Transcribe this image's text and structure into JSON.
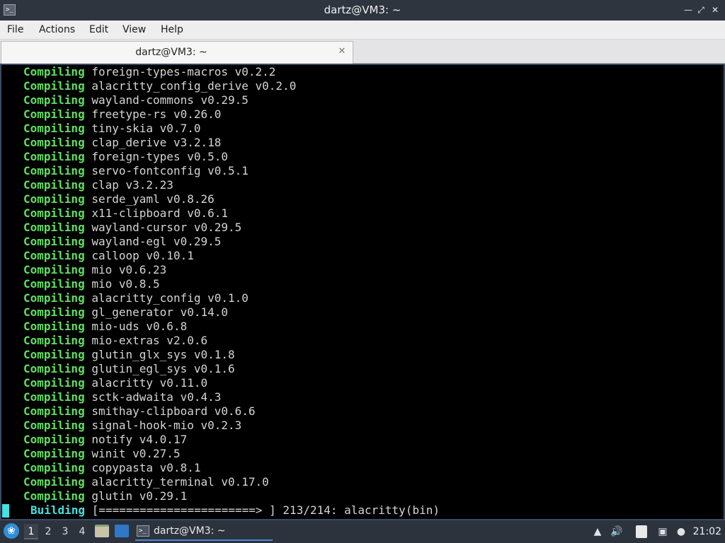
{
  "window": {
    "title": "dartz@VM3: ~",
    "controls": [
      "minimize-icon",
      "maximize-icon",
      "close-icon"
    ]
  },
  "menubar": {
    "items": [
      "File",
      "Actions",
      "Edit",
      "View",
      "Help"
    ]
  },
  "tabs": [
    {
      "label": "dartz@VM3: ~",
      "close_icon": "close-icon"
    }
  ],
  "terminal": {
    "compile_label": "Compiling",
    "lines": [
      "foreign-types-macros v0.2.2",
      "alacritty_config_derive v0.2.0",
      "wayland-commons v0.29.5",
      "freetype-rs v0.26.0",
      "tiny-skia v0.7.0",
      "clap_derive v3.2.18",
      "foreign-types v0.5.0",
      "servo-fontconfig v0.5.1",
      "clap v3.2.23",
      "serde_yaml v0.8.26",
      "x11-clipboard v0.6.1",
      "wayland-cursor v0.29.5",
      "wayland-egl v0.29.5",
      "calloop v0.10.1",
      "mio v0.6.23",
      "mio v0.8.5",
      "alacritty_config v0.1.0",
      "gl_generator v0.14.0",
      "mio-uds v0.6.8",
      "mio-extras v2.0.6",
      "glutin_glx_sys v0.1.8",
      "glutin_egl_sys v0.1.6",
      "alacritty v0.11.0",
      "sctk-adwaita v0.4.3",
      "smithay-clipboard v0.6.6",
      "signal-hook-mio v0.2.3",
      "notify v4.0.17",
      "winit v0.27.5",
      "copypasta v0.8.1",
      "alacritty_terminal v0.17.0",
      "glutin v0.29.1"
    ],
    "status": {
      "label": "Building",
      "text": "[=======================> ] 213/214: alacritty(bin)"
    },
    "accent_green": "#5fe05f",
    "cursor_color": "#45e0e0"
  },
  "taskbar": {
    "start_icon": "lxqt-start-icon",
    "workspaces": [
      "1",
      "2",
      "3",
      "4"
    ],
    "active_workspace": "1",
    "quicklaunch": [
      "file-manager-icon",
      "desktop-icon"
    ],
    "task": {
      "label": "dartz@VM3: ~",
      "icon": "terminal-icon"
    },
    "tray": [
      "update-icon",
      "volume-icon",
      "clipboard-icon",
      "network-icon",
      "bluetooth-icon"
    ],
    "clock": "21:02"
  }
}
